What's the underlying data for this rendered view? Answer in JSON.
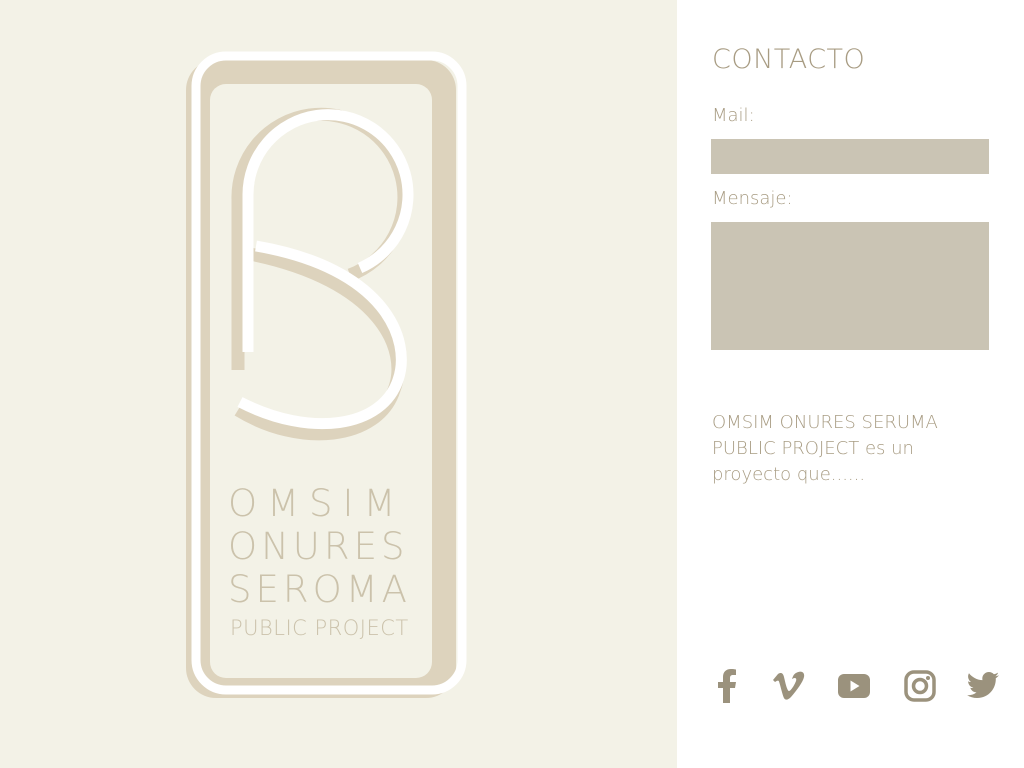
{
  "logo": {
    "line1": "OMSIM",
    "line2": "ONURES",
    "line3": "SEROMA",
    "subtitle": "PUBLIC PROJECT",
    "colors": {
      "light": "#ffffff",
      "shadow": "#ddd3bd",
      "text": "#cbc2ab"
    }
  },
  "contact": {
    "heading": "CONTACTO",
    "mail_label": "Mail:",
    "mail_value": "",
    "message_label": "Mensaje:",
    "message_value": ""
  },
  "about": "OMSIM ONURES SERUMA PUBLIC PROJECT es un proyecto que......",
  "social": [
    {
      "name": "facebook-icon"
    },
    {
      "name": "vimeo-icon"
    },
    {
      "name": "youtube-icon"
    },
    {
      "name": "instagram-icon"
    },
    {
      "name": "twitter-icon"
    }
  ],
  "colors": {
    "left_background": "#f3f2e7",
    "accent_text": "#a89c83",
    "input_fill": "#cac4b4",
    "icon": "#9b927d"
  }
}
